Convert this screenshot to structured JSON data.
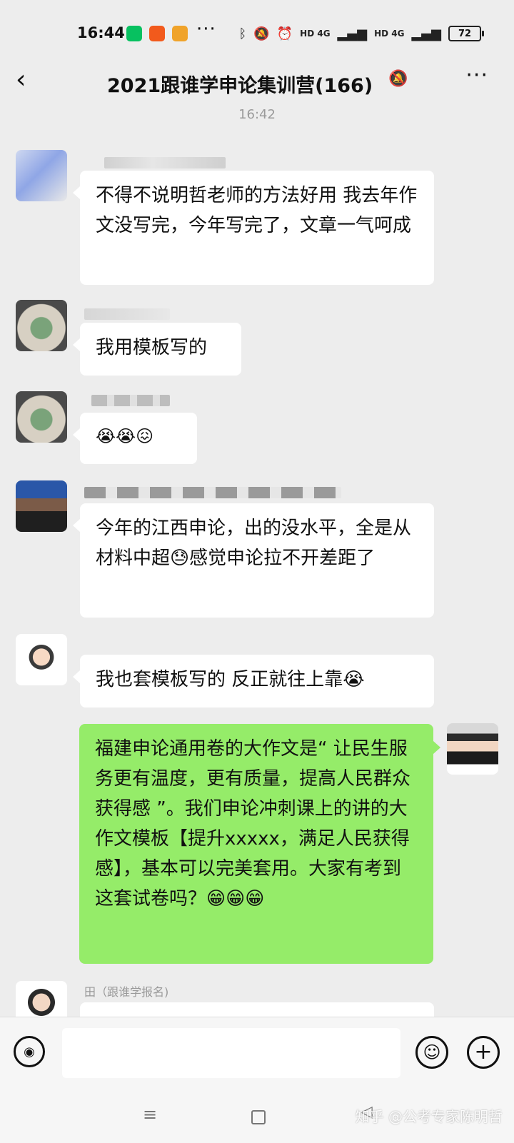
{
  "status_bar": {
    "time": "16:44",
    "battery": "72",
    "net1": "HD 4G",
    "net2": "HD 4G",
    "icons": [
      "wechat-icon",
      "mi-icon",
      "weibo-icon",
      "bluetooth-icon",
      "mute-icon",
      "alarm-icon",
      "signal-icon",
      "battery-icon"
    ]
  },
  "header": {
    "title": "2021跟谁学申论集训营(166)",
    "back_icon": "‹",
    "more_icon": "···"
  },
  "timestamp": "16:42",
  "messages": [
    {
      "text": "不得不说明哲老师的方法好用 我去年作文没写完，今年写完了，文章一气呵成"
    },
    {
      "text": "我用模板写的"
    },
    {
      "text": "😭😭😖"
    },
    {
      "text": "今年的江西申论，出的没水平，全是从材料中超😓感觉申论拉不开差距了"
    },
    {
      "text": "我也套模板写的 反正就往上靠😭"
    },
    {
      "text": "福建申论通用卷的大作文是“ 让民生服务更有温度，更有质量，提高人民群众获得感 ”。我们申论冲刺课上的讲的大作文模板【提升xxxxx，满足人民获得感】，基本可以完美套用。大家有考到这套试卷吗？😁😁😁"
    },
    {
      "sender": "田（跟谁学报名)"
    }
  ],
  "colors": {
    "background": "#ededed",
    "outgoing_bubble": "#95ec69",
    "incoming_bubble": "#ffffff"
  },
  "watermark": "知乎 @公考专家陈明哲"
}
